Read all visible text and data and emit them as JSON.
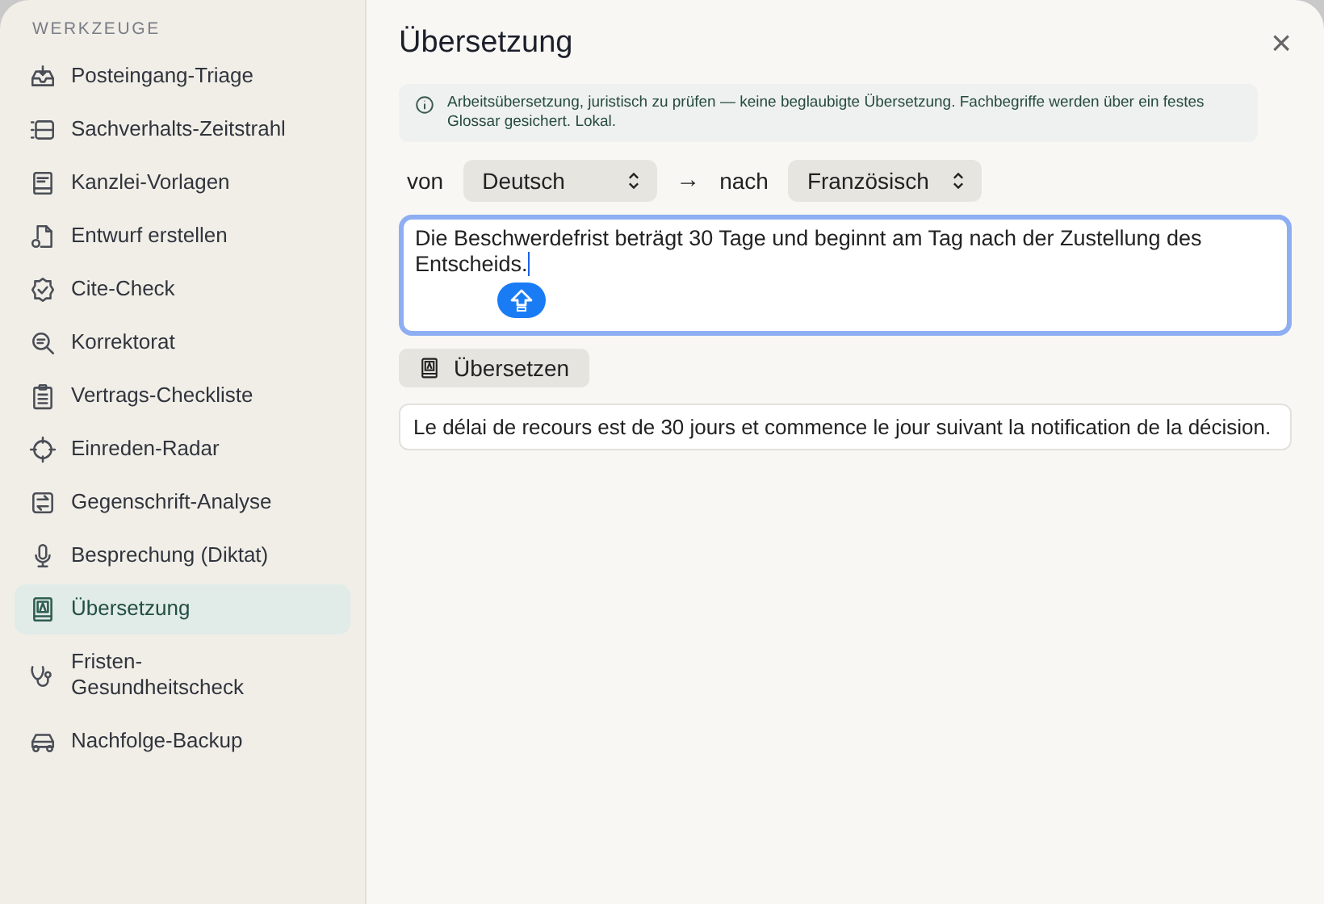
{
  "sidebar": {
    "heading": "WERKZEUGE",
    "items": [
      {
        "label": "Posteingang-Triage",
        "selected": false
      },
      {
        "label": "Sachverhalts-Zeitstrahl",
        "selected": false
      },
      {
        "label": "Kanzlei-Vorlagen",
        "selected": false
      },
      {
        "label": "Entwurf erstellen",
        "selected": false
      },
      {
        "label": "Cite-Check",
        "selected": false
      },
      {
        "label": "Korrektorat",
        "selected": false
      },
      {
        "label": "Vertrags-Checkliste",
        "selected": false
      },
      {
        "label": "Einreden-Radar",
        "selected": false
      },
      {
        "label": "Gegenschrift-Analyse",
        "selected": false
      },
      {
        "label": "Besprechung (Diktat)",
        "selected": false
      },
      {
        "label": "Übersetzung",
        "selected": true
      },
      {
        "label": "Fristen-Gesundheitscheck",
        "selected": false
      },
      {
        "label": "Nachfolge-Backup",
        "selected": false
      }
    ]
  },
  "panel": {
    "title": "Übersetzung",
    "close": "×",
    "notice": "Arbeitsübersetzung, juristisch zu prüfen — keine beglaubigte Übersetzung. Fachbegriffe werden über ein festes Glossar gesichert. Lokal.",
    "from_label": "von",
    "from_value": "Deutsch",
    "arrow": "→",
    "to_label": "nach",
    "to_value": "Französisch",
    "source_text": "Die Beschwerdefrist beträgt 30 Tage und beginnt am Tag nach der Zustellung des Entscheids.",
    "translate_button": "Übersetzen",
    "result": "Le délai de recours est de 30 jours et commence le jour suivant la notification de la décision."
  }
}
